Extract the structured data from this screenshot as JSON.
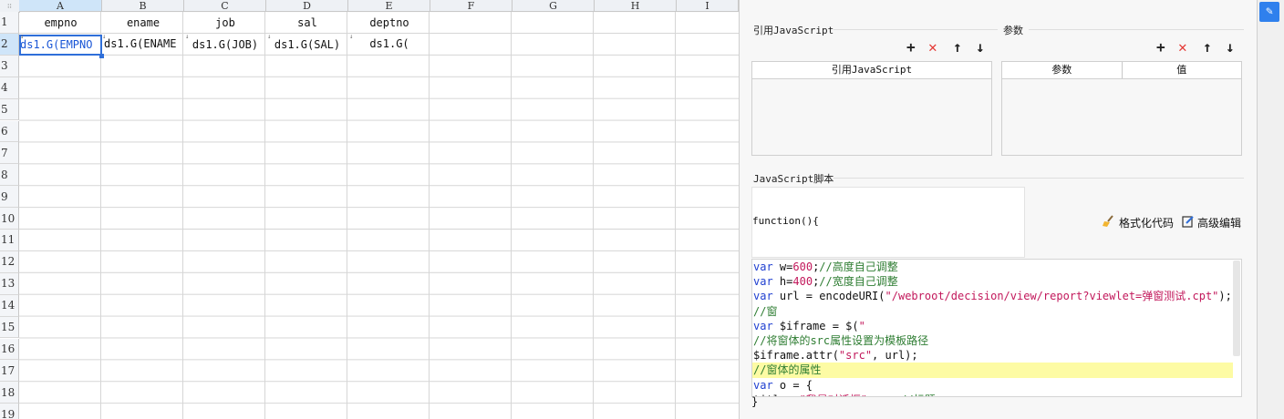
{
  "sheet": {
    "corner_glyph": "∷",
    "columns": [
      "A",
      "B",
      "C",
      "D",
      "E",
      "F",
      "G",
      "H",
      "I"
    ],
    "rows": [
      "1",
      "2",
      "3",
      "4",
      "5",
      "6",
      "7",
      "8",
      "9",
      "10",
      "11",
      "12",
      "13",
      "14",
      "15",
      "16",
      "17",
      "18",
      "19"
    ],
    "selected_column": "A",
    "selected_row": "2",
    "header_row": [
      "empno",
      "ename",
      "job",
      "sal",
      "deptno"
    ],
    "data_row": [
      "ds1.G(EMPNO",
      "ds1.G(ENAME",
      "ds1.G(JOB)",
      "ds1.G(SAL)",
      "ds1.G("
    ],
    "expand_arrow_glyph": "↓"
  },
  "panel": {
    "ref_js": {
      "title": "引用JavaScript",
      "column_header": "引用JavaScript"
    },
    "params": {
      "title": "参数",
      "columns": [
        "参数",
        "值"
      ]
    },
    "toolbar": {
      "add": "+",
      "remove": "✕",
      "up": "↑",
      "down": "↓"
    },
    "script": {
      "title": "JavaScript脚本",
      "prefix": "function(){",
      "format_label": "格式化代码",
      "advanced_label": "高级编辑",
      "suffix": "}",
      "lines": [
        "var w=600;//高度自己调整",
        "var h=400;//宽度自己调整",
        "var url = encodeURI(\"/webroot/decision/view/report?viewlet=弹窗测试.cpt\");",
        "//窗",
        "var $iframe = $(\"",
        "//将窗体的src属性设置为模板路径",
        "$iframe.attr(\"src\", url);",
        "//窗体的属性",
        "var o = {",
        "title: \"我是对话框\",    //标题"
      ]
    }
  },
  "strip": {
    "edit_icon": "✎"
  },
  "colors": {
    "accent": "#2f6fd9",
    "delete": "#e53935",
    "highlight": "#fdfba4"
  }
}
